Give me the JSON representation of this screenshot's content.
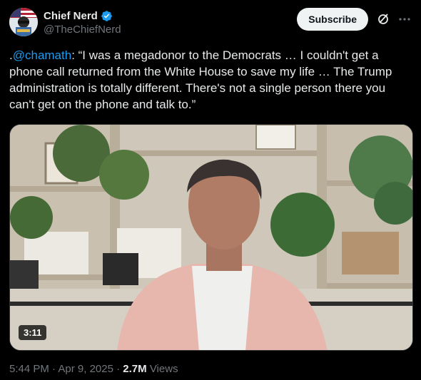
{
  "author": {
    "display_name": "Chief Nerd",
    "handle": "@TheChiefNerd",
    "verified": true
  },
  "actions": {
    "subscribe_label": "Subscribe",
    "grok_icon": "grok-icon",
    "more_icon": "more-icon"
  },
  "tweet": {
    "prefix": ".",
    "mention": "@chamath",
    "body": ": “I was a megadonor to the Democrats … I couldn't get a phone call returned from the White House to save my life … The Trump administration is totally different. There's not a single person there you can't get on the phone and talk to.”"
  },
  "media": {
    "type": "video",
    "duration": "3:11"
  },
  "meta": {
    "time": "5:44 PM",
    "separator": " · ",
    "date": "Apr 9, 2025",
    "views_count": "2.7M",
    "views_label": " Views"
  },
  "colors": {
    "accent": "#1d9bf0",
    "background": "#000000",
    "text": "#e7e9ea",
    "muted": "#71767b"
  }
}
